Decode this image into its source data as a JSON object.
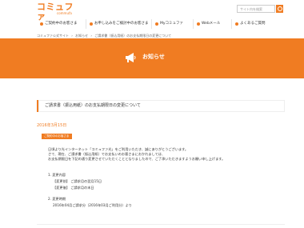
{
  "header": {
    "logo_main": "コミュファ",
    "logo_sub": "commufa",
    "search_placeholder": "サイト内を検索"
  },
  "nav": {
    "items": [
      "ご契約中のお客さま",
      "お申し込みをご検討中のお客さま",
      "Myコミュファ",
      "Webメール",
      "よくあるご質問"
    ]
  },
  "breadcrumb": [
    "コミュファ公式サイト",
    "お知らせ",
    "ご請求書（振込用紙）のお支払期限日の変更について"
  ],
  "banner": {
    "title": "お知らせ"
  },
  "notice": {
    "title": "ご請求書（振込用紙）のお支払期限日の変更について"
  },
  "date": "2016年3月15日",
  "tag": "ご契約中のお客さま",
  "body": {
    "p1": "日頃より光インターネット「コミュファ光」をご利用いただき、誠にありがとうございます。",
    "p2": "さて、現在、ご請求書（振込用紙）でお支払いのお客さまにおかれましては、",
    "p3": "お支払期限日を下記の通り変更させていただくこととなりましたので、ご了承いただきますようお願い申し上げます。",
    "s1": "1. 変更内容",
    "s1a": "【変更前】 ご請求月の翌月15日",
    "s1b": "【変更後】 ご請求月の末日",
    "s2": "2. 変更時期",
    "s2a": "2016年04月ご請求分（2016年03月ご利用分）より"
  }
}
